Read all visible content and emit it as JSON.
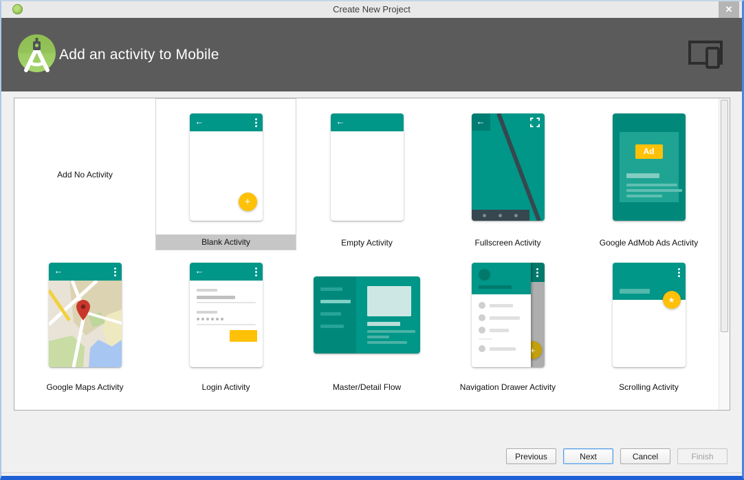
{
  "window": {
    "title": "Create New Project"
  },
  "icons": {
    "close": "✕",
    "back": "←",
    "add": "+",
    "star": "★"
  },
  "header": {
    "title": "Add an activity to Mobile"
  },
  "grid": {
    "admob_badge": "Ad",
    "items": [
      {
        "label": "Add No Activity",
        "selected": false
      },
      {
        "label": "Blank Activity",
        "selected": true
      },
      {
        "label": "Empty Activity",
        "selected": false
      },
      {
        "label": "Fullscreen Activity",
        "selected": false
      },
      {
        "label": "Google AdMob Ads Activity",
        "selected": false
      },
      {
        "label": "Google Maps Activity",
        "selected": false
      },
      {
        "label": "Login Activity",
        "selected": false
      },
      {
        "label": "Master/Detail Flow",
        "selected": false
      },
      {
        "label": "Navigation Drawer Activity",
        "selected": false
      },
      {
        "label": "Scrolling Activity",
        "selected": false
      }
    ]
  },
  "footer": {
    "buttons": [
      {
        "label": "Previous"
      },
      {
        "label": "Next"
      },
      {
        "label": "Cancel"
      },
      {
        "label": "Finish"
      }
    ]
  },
  "colors": {
    "teal": "#009688",
    "teal_dark": "#00796b",
    "amber": "#ffc107",
    "header_bg": "#5b5b5b"
  }
}
